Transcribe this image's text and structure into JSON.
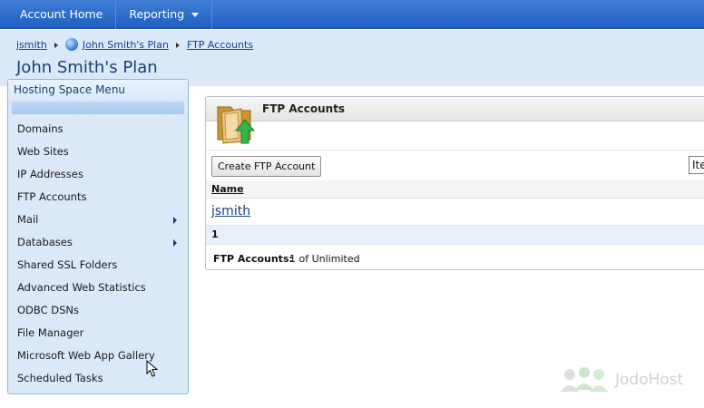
{
  "topnav": {
    "items": [
      "Account Home",
      "Reporting"
    ]
  },
  "breadcrumb": {
    "items": [
      "jsmith",
      "John Smith's Plan",
      "FTP Accounts"
    ]
  },
  "page": {
    "title": "John Smith's Plan"
  },
  "sidebar": {
    "header": "Hosting Space Menu",
    "items": [
      {
        "label": "Domains",
        "submenu": false
      },
      {
        "label": "Web Sites",
        "submenu": false
      },
      {
        "label": "IP Addresses",
        "submenu": false
      },
      {
        "label": "FTP Accounts",
        "submenu": false
      },
      {
        "label": "Mail",
        "submenu": true
      },
      {
        "label": "Databases",
        "submenu": true
      },
      {
        "label": "Shared SSL Folders",
        "submenu": false
      },
      {
        "label": "Advanced Web Statistics",
        "submenu": false
      },
      {
        "label": "ODBC DSNs",
        "submenu": false
      },
      {
        "label": "File Manager",
        "submenu": false
      },
      {
        "label": "Microsoft Web App Gallery",
        "submenu": false
      },
      {
        "label": "Scheduled Tasks",
        "submenu": false
      }
    ]
  },
  "panel": {
    "title": "FTP Accounts",
    "create_button": "Create FTP Account",
    "items_box": "Ite",
    "column_name": "Name",
    "rows": [
      "jsmith"
    ],
    "pager_page": "1",
    "summary_label": "FTP Accounts:",
    "summary_value": "1 of Unlimited"
  },
  "watermark": {
    "text": "JodoHost"
  },
  "colors": {
    "topbar": "#2a6bcb",
    "header_bg": "#dbe8f8",
    "link": "#1a3f8f",
    "title": "#1b3e74"
  },
  "icons": [
    "globe-icon",
    "folder-upload-icon",
    "submenu-arrow-icon",
    "mouse-cursor-icon",
    "people-icon"
  ]
}
